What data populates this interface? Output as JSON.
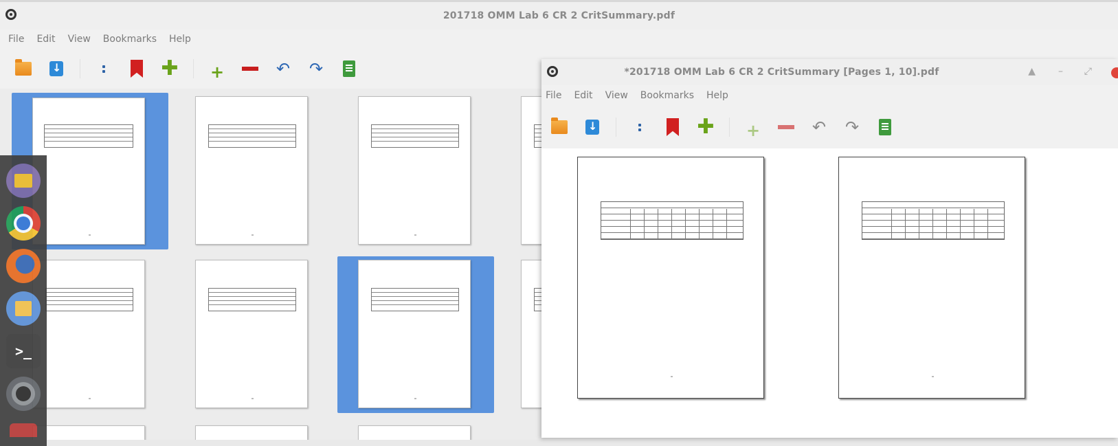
{
  "main_window": {
    "title": "201718 OMM Lab 6 CR 2 CritSummary.pdf",
    "menu": [
      "File",
      "Edit",
      "View",
      "Bookmarks",
      "Help"
    ],
    "toolbar_icons": [
      "open-folder-icon",
      "save-icon",
      "dots-icon",
      "bookmark-icon",
      "add-icon",
      "add-pages-icon",
      "remove-icon",
      "rotate-left-icon",
      "rotate-right-icon",
      "export-doc-icon"
    ],
    "selected_thumbnails": [
      1,
      7
    ]
  },
  "second_window": {
    "title": "*201718 OMM Lab 6 CR 2 CritSummary [Pages 1, 10].pdf",
    "menu": [
      "File",
      "Edit",
      "View",
      "Bookmarks",
      "Help"
    ],
    "controls": [
      "▲",
      "–",
      "⤢"
    ]
  },
  "launcher": [
    "files-app",
    "chrome",
    "firefox",
    "archive-manager",
    "terminal",
    "disc-utility"
  ],
  "colors": {
    "selection": "#5b93dd",
    "bookmark": "#d12020",
    "add": "#6aa31a",
    "remove": "#c81e1e"
  }
}
